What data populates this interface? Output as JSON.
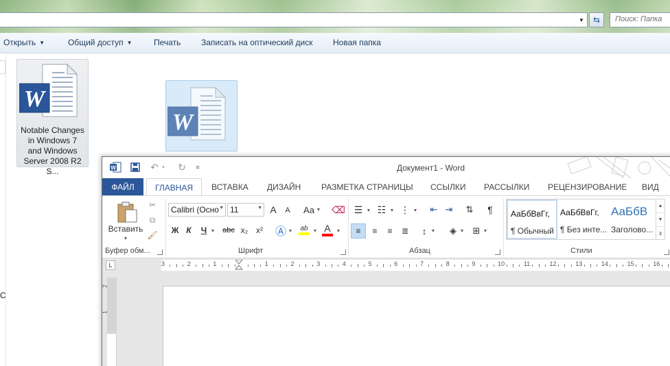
{
  "explorer": {
    "search_placeholder": "Поиск: Папка",
    "toolbar": {
      "open_label": "Открыть",
      "share_label": "Общий доступ",
      "print_label": "Печать",
      "burn_label": "Записать на оптический диск",
      "new_folder_label": "Новая папка"
    },
    "file": {
      "name": "Notable Changes in Windows 7 and Windows Server 2008 R2 S...",
      "name_lines": [
        "Notable Changes",
        "in Windows 7",
        "and Windows",
        "Server 2008 R2 S..."
      ],
      "icon": "word-document-icon"
    },
    "nav_glyph": "С"
  },
  "word": {
    "title": "Документ1 - Word",
    "tabs": [
      "ФАЙЛ",
      "ГЛАВНАЯ",
      "ВСТАВКА",
      "ДИЗАЙН",
      "РАЗМЕТКА СТРАНИЦЫ",
      "ССЫЛКИ",
      "РАССЫЛКИ",
      "РЕЦЕНЗИРОВАНИЕ",
      "ВИД"
    ],
    "active_tab": "ГЛАВНАЯ",
    "ribbon": {
      "paste_label": "Вставить",
      "clipboard_group": "Буфер обм...",
      "font_group": "Шрифт",
      "paragraph_group": "Абзац",
      "styles_group": "Стили",
      "font_name": "Calibri (Осно",
      "font_size": "11",
      "bold": "Ж",
      "italic": "К",
      "underline": "Ч",
      "strike": "abc",
      "sub": "x₂",
      "sup": "x²",
      "case": "Aa",
      "grow": "A",
      "shrink": "A",
      "styles": [
        {
          "preview": "АаБбВвГг,",
          "name": "¶ Обычный"
        },
        {
          "preview": "АаБбВвГг,",
          "name": "¶ Без инте..."
        },
        {
          "preview": "АаБбВ",
          "name": "Заголово..."
        }
      ]
    },
    "ruler": {
      "tab_selector": "L",
      "labels": [
        "3",
        "2",
        "1",
        "",
        "1",
        "2",
        "3",
        "4",
        "5",
        "6",
        "7",
        "8",
        "9",
        "10",
        "11",
        "12",
        "13",
        "14",
        "15",
        "16"
      ],
      "vertical_labels": [
        "2",
        "1"
      ]
    },
    "colors": {
      "accent": "#2b579a",
      "highlight": "#ffff00",
      "font_color": "#ff0000"
    }
  }
}
